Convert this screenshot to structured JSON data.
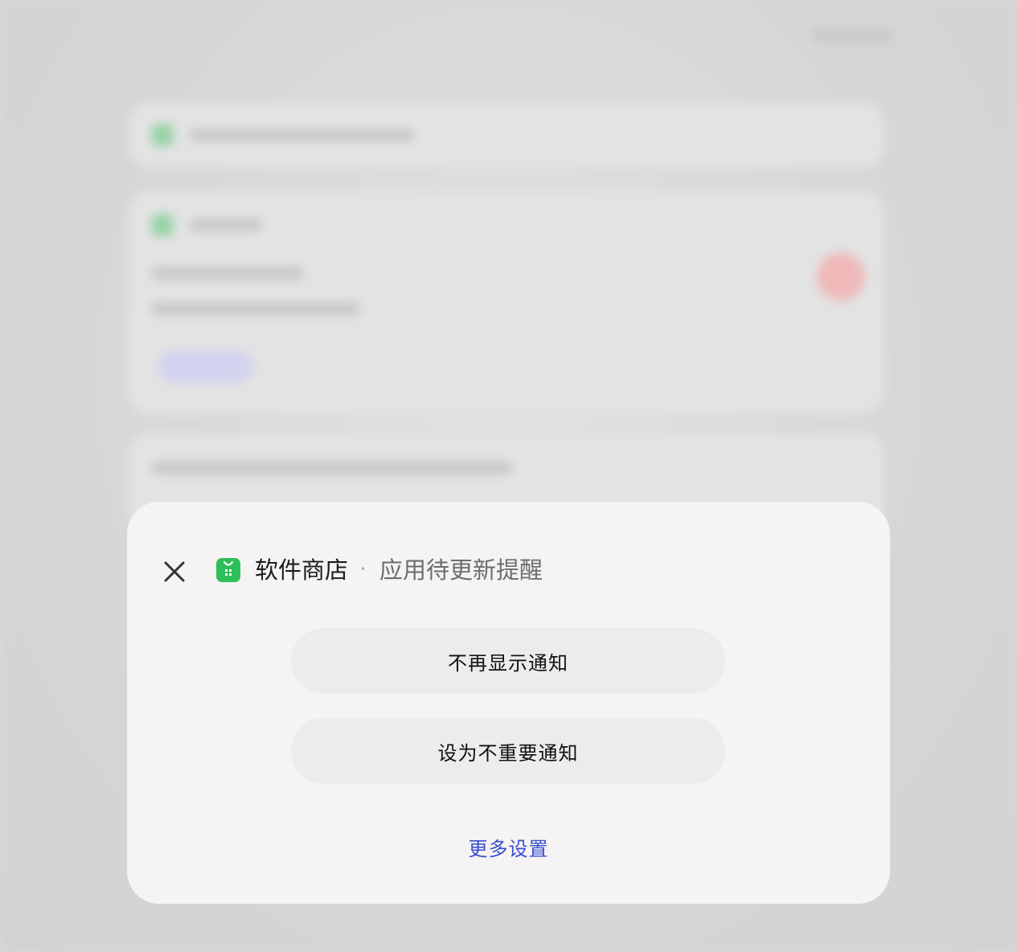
{
  "dialog": {
    "app_name": "软件商店",
    "separator": "·",
    "channel_name": "应用待更新提醒",
    "close_icon": "close-icon",
    "app_icon": "app-store-icon",
    "buttons": {
      "disable_label": "不再显示通知",
      "unimportant_label": "设为不重要通知"
    },
    "more_settings_label": "更多设置"
  },
  "colors": {
    "sheet_bg": "#f5f3f4",
    "button_bg": "#ececec",
    "link": "#3a4fd0",
    "app_icon_green": "#34c759"
  }
}
